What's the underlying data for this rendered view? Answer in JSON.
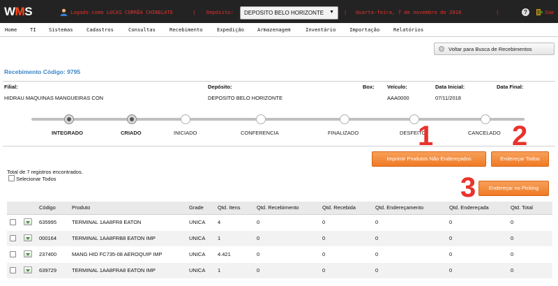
{
  "header": {
    "logo_text_a": "W",
    "logo_text_b": "M",
    "logo_text_c": "S",
    "user_text": "Logado como LUCAS CORRÊA CHINELATE",
    "separator": "|",
    "deposit_label": "Depósito:",
    "deposit_value": "DEPOSITO BELO HORIZONTE",
    "date_text": "Quarta-feira, 7 de novembro de 2018",
    "help_icon": "?",
    "exit_label": "Sair"
  },
  "menu": {
    "items": [
      "Home",
      "TI",
      "Sistemas",
      "Cadastros",
      "Consultas",
      "Recebimento",
      "Expedição",
      "Armazenagem",
      "Inventário",
      "Importação",
      "Relatórios"
    ]
  },
  "back_button_label": "Voltar para Busca de Recebimentos",
  "page_title": "Recebimento Código: 9795",
  "info": {
    "filial_label": "Filial:",
    "filial_value": "HIDRAU MAQUINAS MANGUEIRAS CON",
    "deposito_label": "Depósito:",
    "deposito_value": "DEPOSITO BELO HORIZONTE",
    "box_label": "Box:",
    "veiculo_label": "Veículo:",
    "veiculo_value": "AAA0000",
    "data_inicial_label": "Data Inicial:",
    "data_inicial_value": "07/11/2018",
    "data_final_label": "Data Final:"
  },
  "stages": [
    "INTEGRADO",
    "CRIADO",
    "INICIADO",
    "CONFERENCIA",
    "FINALIZADO",
    "DESFEITO",
    "CANCELADO"
  ],
  "actions": {
    "print_label": "Imprimir Produtos Não Endereçados",
    "address_all_label": "Endereçar Todos",
    "address_picking_label": "Endereçar no Picking"
  },
  "annotations": [
    "1",
    "2",
    "3"
  ],
  "total_text": "Total de 7 registros encontrados.",
  "select_all_label": "Selecionar Todos",
  "table": {
    "columns": [
      "",
      "",
      "Código",
      "Produto",
      "Grade",
      "Qtd. Itens",
      "Qtd. Recebimento",
      "Qtd. Recebida",
      "Qtd. Endereçamento",
      "Qtd. Endereçada",
      "Qtd. Total"
    ],
    "rows": [
      {
        "codigo": "635995",
        "produto": "TERMINAL 1AA8FR8 EATON",
        "grade": "UNICA",
        "itens": "4",
        "recebimento": "0",
        "recebida": "0",
        "enderecamento": "0",
        "enderecada": "0",
        "total": "0"
      },
      {
        "codigo": "000164",
        "produto": "TERMINAL 1AA8FRB8 EATON IMP",
        "grade": "UNICA",
        "itens": "1",
        "recebimento": "0",
        "recebida": "0",
        "enderecamento": "0",
        "enderecada": "0",
        "total": "0"
      },
      {
        "codigo": "237400",
        "produto": "MANG HID FC735-08 AEROQUIP IMP",
        "grade": "UNICA",
        "itens": "4.421",
        "recebimento": "0",
        "recebida": "0",
        "enderecamento": "0",
        "enderecada": "0",
        "total": "0"
      },
      {
        "codigo": "639729",
        "produto": "TERMINAL 1AA8FRA8 EATON IMP",
        "grade": "UNICA",
        "itens": "1",
        "recebimento": "0",
        "recebida": "0",
        "enderecamento": "0",
        "enderecada": "0",
        "total": "0"
      }
    ]
  },
  "colors": {
    "topbar": "#232323",
    "header_text": "#e8322b",
    "title_blue": "#3a86c8",
    "orange": "#ef7a24",
    "annotation_red": "#e8322b"
  }
}
